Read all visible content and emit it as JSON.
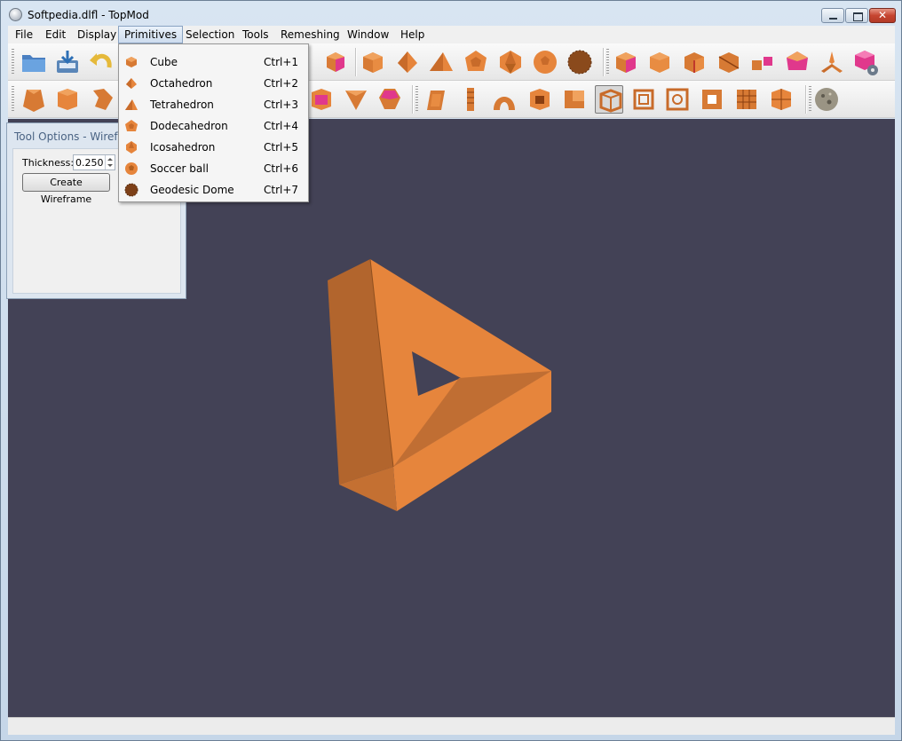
{
  "window": {
    "title": "Softpedia.dlfl - TopMod"
  },
  "menu": {
    "items": [
      "File",
      "Edit",
      "Display",
      "Primitives",
      "Selection",
      "Tools",
      "Remeshing",
      "Window",
      "Help"
    ],
    "open_index": 3
  },
  "primitives_menu": [
    {
      "label": "Cube",
      "shortcut": "Ctrl+1",
      "icon": "cube-icon"
    },
    {
      "label": "Octahedron",
      "shortcut": "Ctrl+2",
      "icon": "octahedron-icon"
    },
    {
      "label": "Tetrahedron",
      "shortcut": "Ctrl+3",
      "icon": "tetrahedron-icon"
    },
    {
      "label": "Dodecahedron",
      "shortcut": "Ctrl+4",
      "icon": "dodecahedron-icon"
    },
    {
      "label": "Icosahedron",
      "shortcut": "Ctrl+5",
      "icon": "icosahedron-icon"
    },
    {
      "label": "Soccer ball",
      "shortcut": "Ctrl+6",
      "icon": "soccer-ball-icon"
    },
    {
      "label": "Geodesic Dome",
      "shortcut": "Ctrl+7",
      "icon": "geodesic-dome-icon"
    }
  ],
  "tool_options": {
    "title": "Tool Options - Wirefra",
    "thickness_label": "Thickness:",
    "thickness_value": "0.250",
    "create_button": "Create Wireframe"
  },
  "colors": {
    "viewport_bg": "#434256",
    "model_orange": "#e6853c",
    "highlight_magenta": "#e0388c"
  }
}
